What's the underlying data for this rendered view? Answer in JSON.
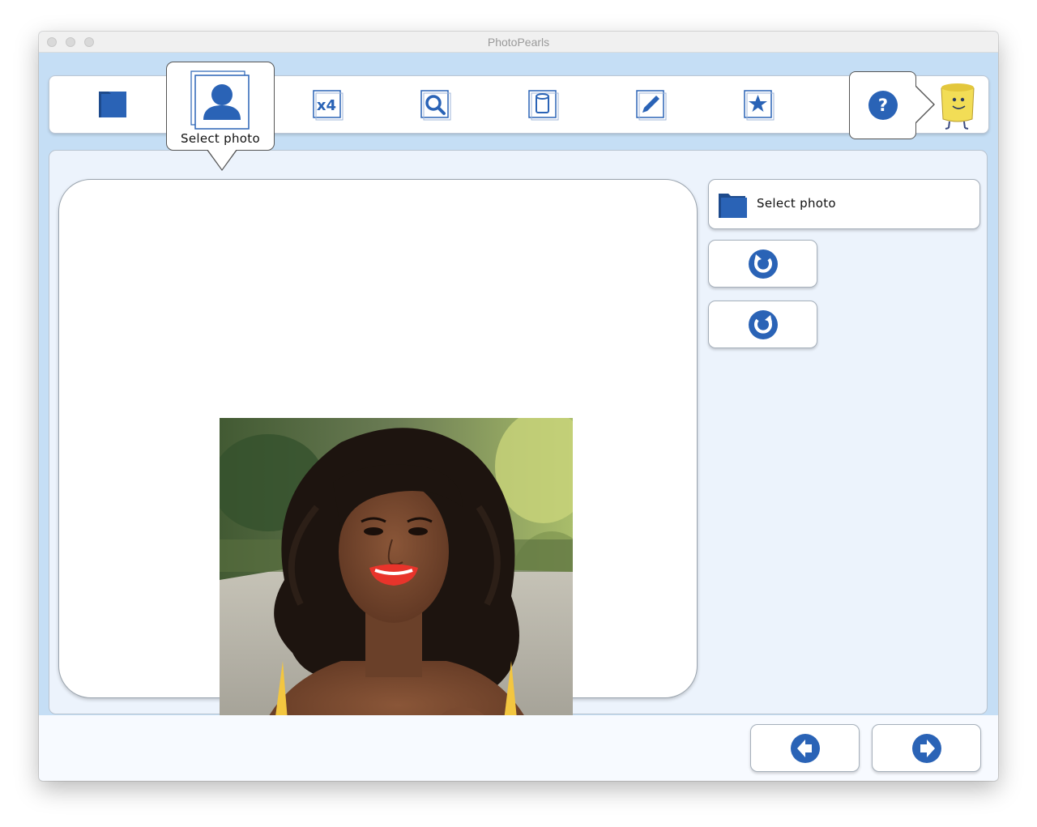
{
  "window": {
    "title": "PhotoPearls"
  },
  "toolbar": {
    "tools": [
      {
        "name": "open-folder",
        "icon": "folder-icon"
      },
      {
        "name": "select-photo",
        "icon": "person-photo-icon",
        "label": "Select photo",
        "active": true
      },
      {
        "name": "x4",
        "icon": "x4-icon",
        "text": "x4"
      },
      {
        "name": "zoom",
        "icon": "magnifier-icon"
      },
      {
        "name": "roll",
        "icon": "pearl-roll-icon"
      },
      {
        "name": "edit",
        "icon": "pencil-icon"
      },
      {
        "name": "favorite",
        "icon": "star-icon"
      }
    ],
    "help": {
      "icon": "help-icon",
      "text": "?"
    },
    "mascot": {
      "icon": "pearl-mascot-icon"
    }
  },
  "sidebar": {
    "select_photo_label": "Select photo",
    "rotate_left_icon": "rotate-counterclockwise-icon",
    "rotate_right_icon": "rotate-clockwise-icon"
  },
  "footer": {
    "back_icon": "arrow-left-icon",
    "next_icon": "arrow-right-icon"
  },
  "colors": {
    "accent": "#2a63b6",
    "window_bg": "#c5def5",
    "panel_bg": "#ecf3fc",
    "mascot_yellow": "#f2dd56"
  }
}
